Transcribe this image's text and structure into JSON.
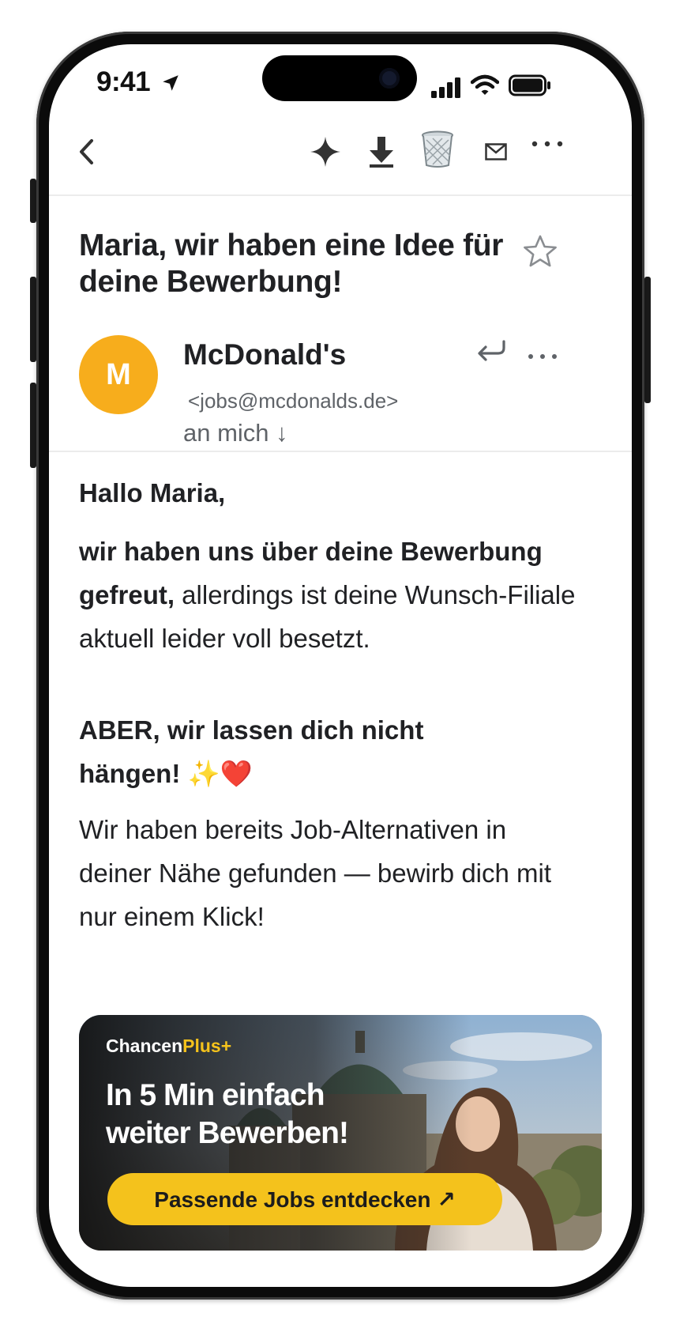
{
  "status_bar": {
    "time": "9:41"
  },
  "toolbar": {
    "icons": [
      "back-chevron-icon",
      "sparkle-icon",
      "download-icon",
      "trash-icon",
      "mail-icon",
      "more-icon"
    ]
  },
  "email": {
    "subject": "Maria, wir haben eine Idee für deine Bewerbung!",
    "sender": {
      "avatar_letter": "M",
      "avatar_color": "#F7AD1C",
      "name": "McDonald's",
      "address": "<jobs@mcdonalds.de>",
      "recipient": "an mich ↓"
    },
    "body": {
      "greeting": "Hallo Maria,",
      "p1_bold": "wir haben uns über deine Bewerbung gefreut,",
      "p1_rest": " allerdings ist deine Wunsch-Filiale aktuell leider voll besetzt.",
      "p2_bold": "ABER, wir lassen dich nicht hängen!",
      "p2_emoji": " ✨❤️",
      "p3": "Wir haben bereits Job-Alternativen in deiner Nähe gefunden — bewirb dich mit nur einem Klick!"
    },
    "banner": {
      "brand_a": "Chancen",
      "brand_b": "Plus+",
      "headline_1": "In 5 Min einfach",
      "headline_2": "weiter Bewerben!",
      "cta": "Passende Jobs entdecken ↗",
      "accent_color": "#F4C21C"
    }
  }
}
